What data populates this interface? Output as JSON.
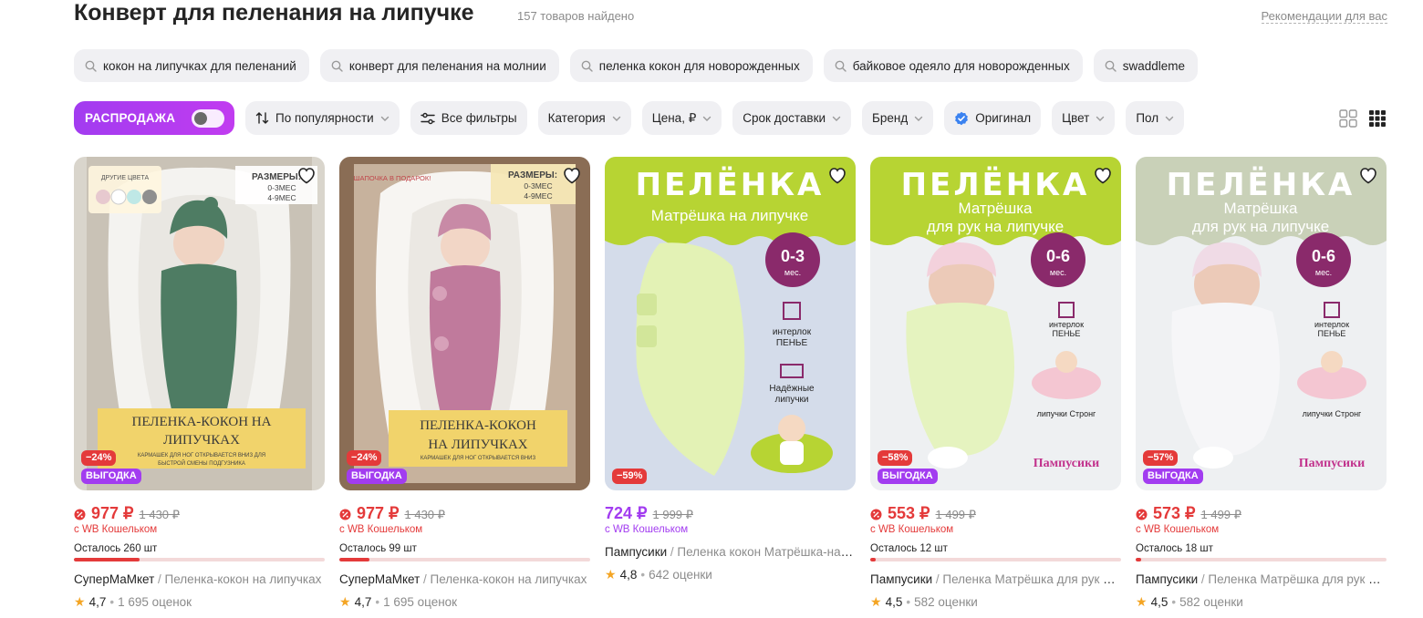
{
  "header": {
    "title": "Конверт для пеленания на липучке",
    "count": "157 товаров найдено",
    "recommend": "Рекомендации для вас"
  },
  "suggestions": [
    "кокон на липучках для пеленаний",
    "конверт для пеленания на молнии",
    "пеленка кокон для новорожденных",
    "байковое одеяло для новорожденных",
    "swaddleme"
  ],
  "filters": {
    "sale": "РАСПРОДАЖА",
    "sale_on": false,
    "sort": "По популярности",
    "all_filters": "Все фильтры",
    "category": "Категория",
    "price": "Цена, ₽",
    "delivery": "Срок доставки",
    "brand": "Бренд",
    "original": "Оригинал",
    "color": "Цвет",
    "gender": "Пол"
  },
  "colors": {
    "accent_purple": "#a23cf0",
    "discount_red": "#e43a3a",
    "chip_bg": "#f0f0f3"
  },
  "products": [
    {
      "discount": "−24%",
      "promo": "ВЫГОДКА",
      "price": "977 ₽",
      "old_price": "1 430 ₽",
      "wallet": "с WB Кошельком",
      "stock": "Осталось 260 шт",
      "stock_level": 0.26,
      "brand": "СуперМаМкет",
      "name": "Пеленка-кокон на липучках",
      "rating": "4,7",
      "reviews": "1 695 оценок",
      "image": {
        "variant": "cocoon-green",
        "caption": "ПЕЛЕНКА-КОКОН НА ЛИПУЧКАХ",
        "subcaption": "КАРМАШЕК ДЛЯ НОГ ОТКРЫВАЕТСЯ ВНИЗ ДЛЯ БЫСТРОЙ СМЕНЫ ПОДГУЗНИКА",
        "corner_title": "ДРУГИЕ ЦВЕТА",
        "sizes_title": "РАЗМЕРЫ:",
        "sizes": [
          "0-3МЕС",
          "4-9МЕС"
        ]
      }
    },
    {
      "discount": "−24%",
      "promo": "ВЫГОДКА",
      "price": "977 ₽",
      "old_price": "1 430 ₽",
      "wallet": "с WB Кошельком",
      "stock": "Осталось 99 шт",
      "stock_level": 0.12,
      "brand": "СуперМаМкет",
      "name": "Пеленка-кокон на липучках",
      "rating": "4,7",
      "reviews": "1 695 оценок",
      "image": {
        "variant": "cocoon-pink",
        "caption": "ПЕЛЕНКА-КОКОН НА ЛИПУЧКАХ",
        "subcaption": "КАРМАШЕК ДЛЯ НОГ ОТКРЫВАЕТСЯ ВНИЗ ДЛЯ БЫСТРОЙ СМЕНЫ ПОДГУЗНИКА",
        "corner_title": "ШАПОЧКА В ПОДАРОК!",
        "sizes_title": "РАЗМЕРЫ:",
        "sizes": [
          "0-3МЕС",
          "4-9МЕС"
        ]
      }
    },
    {
      "discount": "−59%",
      "promo": "",
      "price": "724 ₽",
      "old_price": "1 999 ₽",
      "wallet": "с WB Кошельком",
      "stock": "",
      "stock_level": null,
      "brand": "Пампусики",
      "name": "Пеленка кокон Матрёшка-на липучке",
      "rating": "4,8",
      "reviews": "642 оценки",
      "image": {
        "variant": "matryoshka-flat",
        "headline": "ПЕЛЁНКА",
        "subheadline": "Матрёшка на липучке",
        "age": "0-3",
        "age_unit": "мес.",
        "feature1": "интерлок ПЕНЬЕ",
        "feature2": "Надёжные липучки"
      }
    },
    {
      "discount": "−58%",
      "promo": "ВЫГОДКА",
      "price": "553 ₽",
      "old_price": "1 499 ₽",
      "wallet": "с WB Кошельком",
      "stock": "Осталось 12 шт",
      "stock_level": 0.02,
      "brand": "Пампусики",
      "name": "Пеленка Матрёшка для рук на липучке",
      "rating": "4,5",
      "reviews": "582 оценки",
      "image": {
        "variant": "matryoshka-green",
        "headline": "ПЕЛЁНКА",
        "subheadline": "Матрёшка для рук на липучке",
        "age": "0-6",
        "age_unit": "мес.",
        "feature1": "интерлок ПЕНЬЕ",
        "feature2": "липучки Стронг",
        "logo": "Пампусики"
      }
    },
    {
      "discount": "−57%",
      "promo": "ВЫГОДКА",
      "price": "573 ₽",
      "old_price": "1 499 ₽",
      "wallet": "с WB Кошельком",
      "stock": "Осталось 18 шт",
      "stock_level": 0.02,
      "brand": "Пампусики",
      "name": "Пеленка Матрёшка для рук на липучке",
      "rating": "4,5",
      "reviews": "582 оценки",
      "image": {
        "variant": "matryoshka-white",
        "headline": "ПЕЛЁНКА",
        "subheadline": "Матрёшка для рук на липучке",
        "age": "0-6",
        "age_unit": "мес.",
        "feature1": "интерлок ПЕНЬЕ",
        "feature2": "липучки Стронг",
        "logo": "Пампусики"
      }
    }
  ]
}
